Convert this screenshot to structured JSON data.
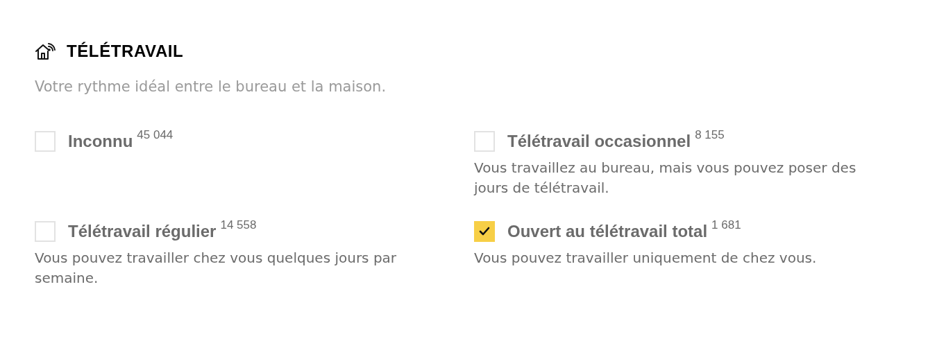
{
  "section": {
    "title": "TÉLÉTRAVAIL",
    "subtitle": "Votre rythme idéal entre le bureau et la maison."
  },
  "options": [
    {
      "label": "Inconnu",
      "count": "45 044",
      "checked": false
    },
    {
      "label": "Télétravail occasionnel",
      "count": "8 155",
      "checked": false,
      "description": "Vous travaillez au bureau, mais vous pouvez poser des jours de télétravail."
    },
    {
      "label": "Télétravail régulier",
      "count": "14 558",
      "checked": false,
      "description": "Vous pouvez travailler chez vous quelques jours par semaine."
    },
    {
      "label": "Ouvert au télétravail total",
      "count": "1 681",
      "checked": true,
      "description": "Vous pouvez travailler uniquement de chez vous."
    }
  ]
}
